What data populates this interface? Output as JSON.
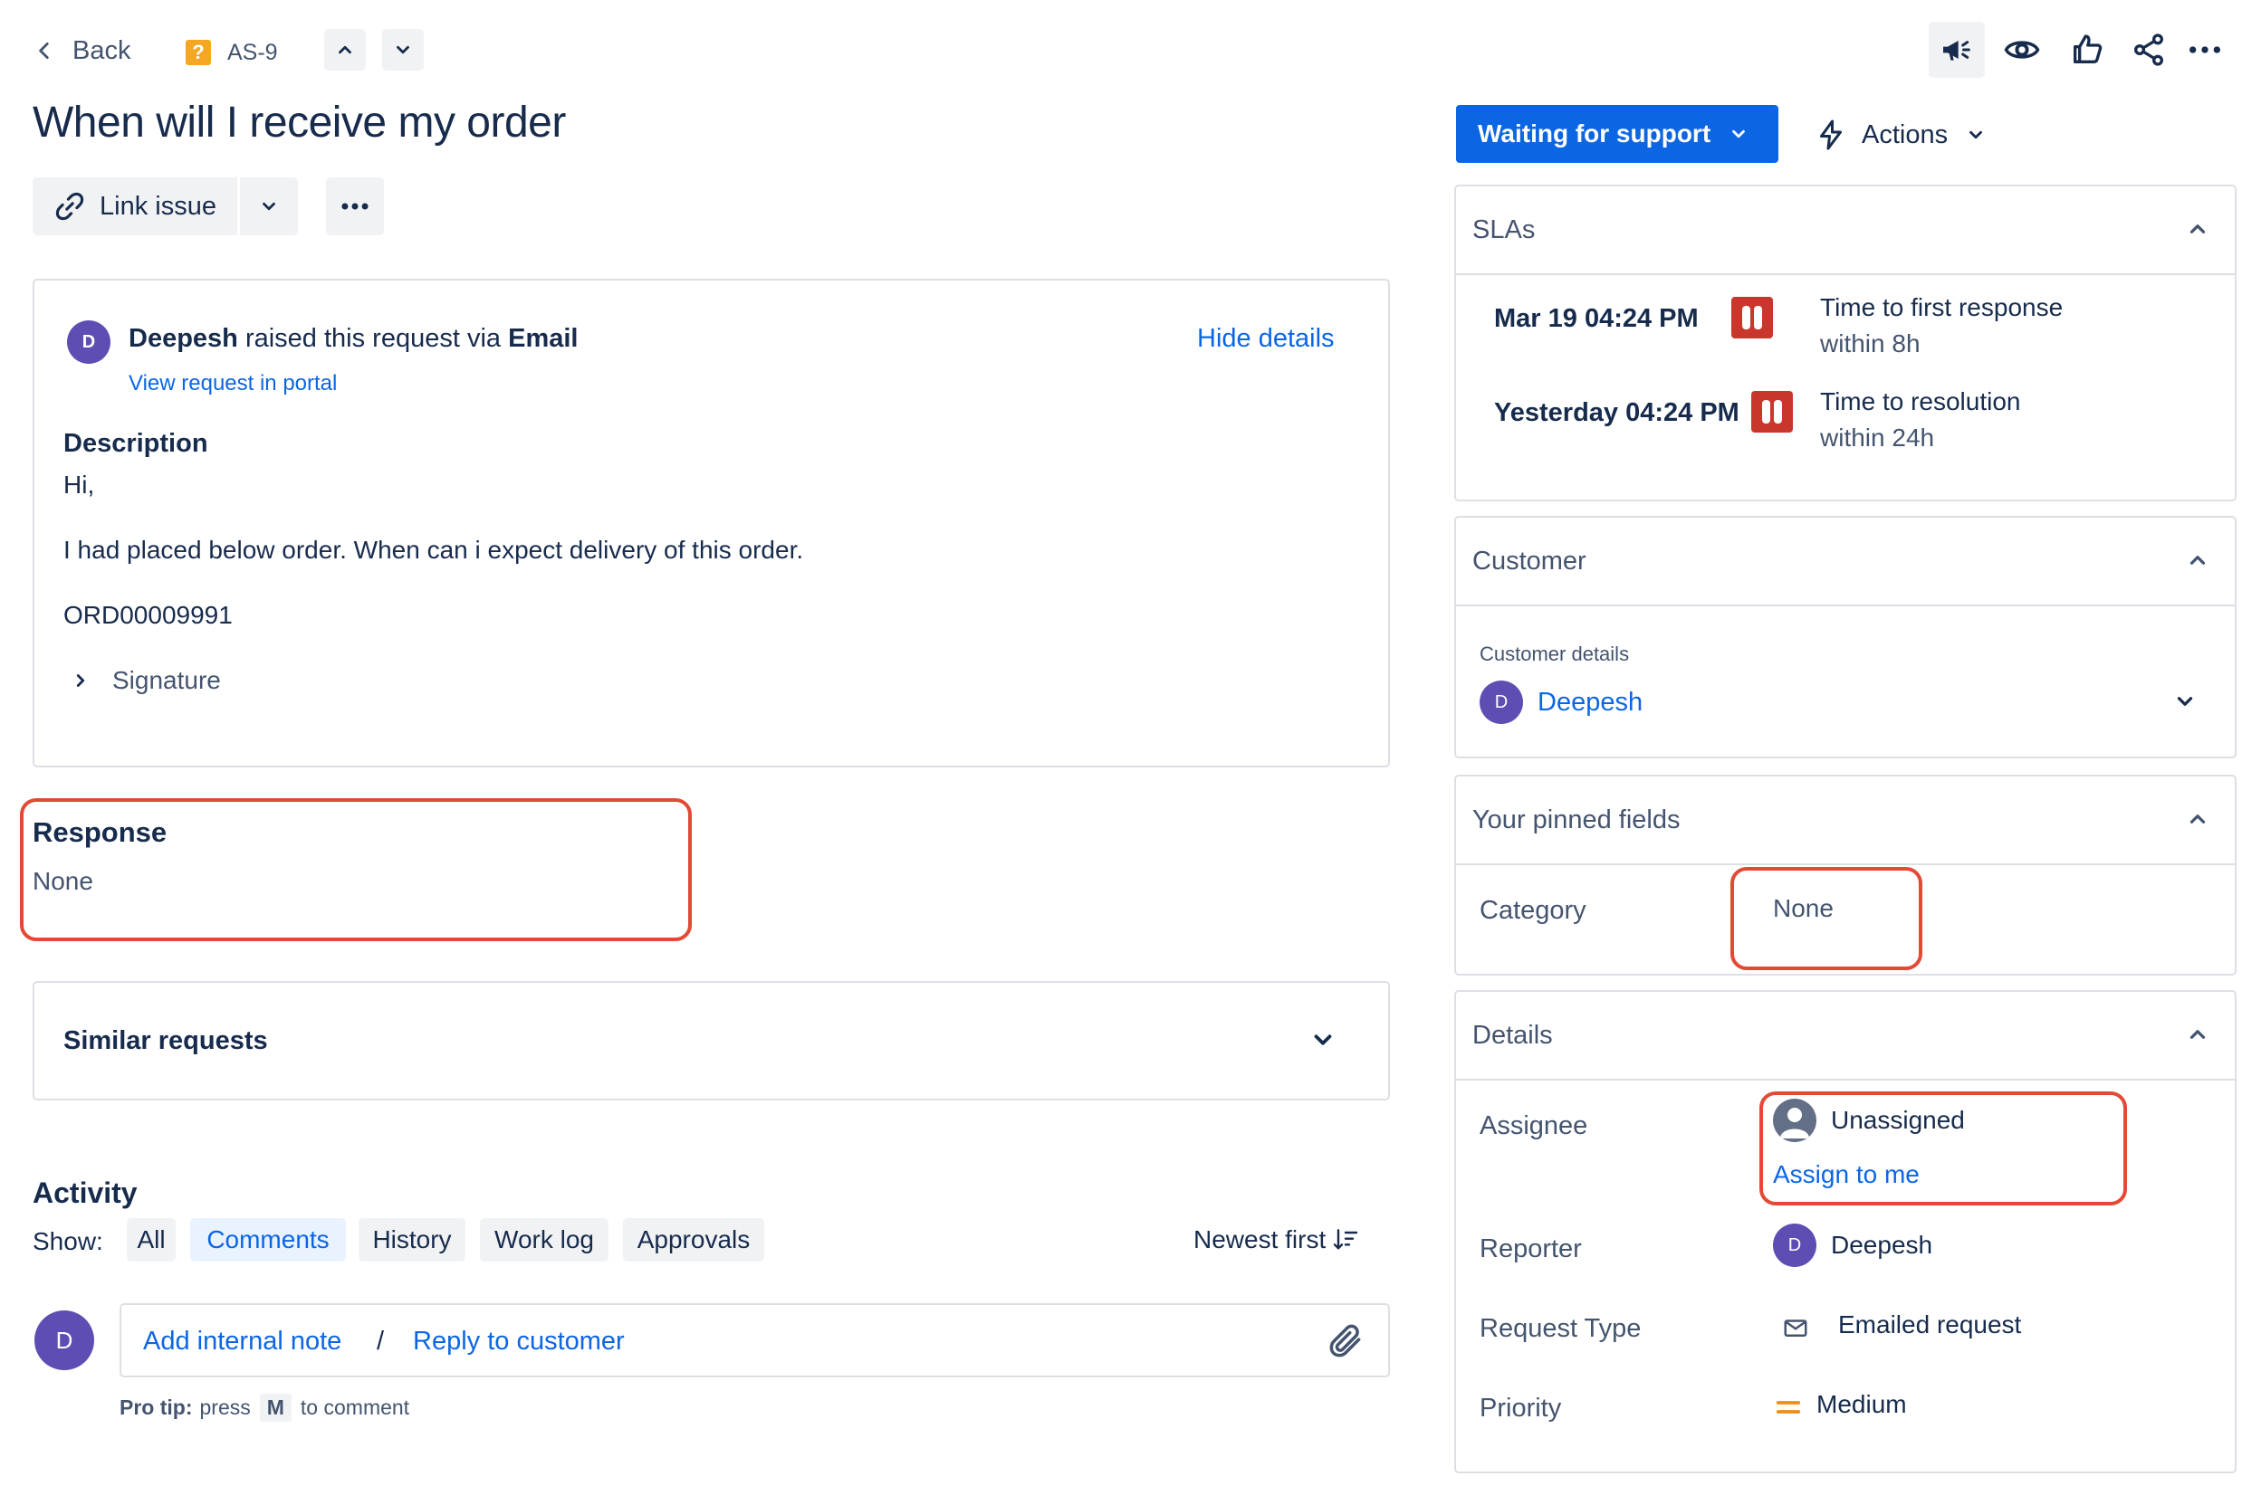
{
  "topbar": {
    "back_label": "Back",
    "issue_key": "AS-9",
    "issue_type_glyph": "?",
    "colors": {
      "issue_type": "#f5a623",
      "accent": "#0c66e4",
      "highlight": "#e34935"
    }
  },
  "title": "When will I receive my order",
  "toolbar": {
    "link_issue_label": "Link issue"
  },
  "request": {
    "avatar_initial": "D",
    "raiser": "Deepesh",
    "raised_via_text": "raised this request via",
    "channel": "Email",
    "hide_details": "Hide details",
    "view_in_portal": "View request in portal",
    "description_label": "Description",
    "lines": [
      "Hi,",
      "I had placed below order. When can i expect delivery of this order.",
      "ORD00009991"
    ],
    "signature_label": "Signature"
  },
  "response": {
    "label": "Response",
    "value": "None"
  },
  "similar": {
    "label": "Similar requests"
  },
  "activity": {
    "title": "Activity",
    "show_label": "Show:",
    "filters": [
      "All",
      "Comments",
      "History",
      "Work log",
      "Approvals"
    ],
    "active_filter": "Comments",
    "sort_label": "Newest first",
    "commenter_initial": "D",
    "add_internal_note": "Add internal note",
    "separator": "/",
    "reply_to_customer": "Reply to customer",
    "protip_bold": "Pro tip:",
    "protip_press": "press",
    "protip_key": "M",
    "protip_rest": "to comment"
  },
  "status": {
    "label": "Waiting for support",
    "actions_label": "Actions"
  },
  "slas": {
    "title": "SLAs",
    "items": [
      {
        "time": "Mar 19 04:24 PM",
        "name": "Time to first response",
        "goal": "within 8h",
        "state": "paused"
      },
      {
        "time": "Yesterday 04:24 PM",
        "name": "Time to resolution",
        "goal": "within 24h",
        "state": "paused"
      }
    ]
  },
  "customer": {
    "title": "Customer",
    "details_label": "Customer details",
    "avatar_initial": "D",
    "name": "Deepesh"
  },
  "pinned": {
    "title": "Your pinned fields",
    "category_label": "Category",
    "category_value": "None"
  },
  "details": {
    "title": "Details",
    "assignee_label": "Assignee",
    "assignee_value": "Unassigned",
    "assign_to_me": "Assign to me",
    "reporter_label": "Reporter",
    "reporter_initial": "D",
    "reporter_value": "Deepesh",
    "request_type_label": "Request Type",
    "request_type_value": "Emailed request",
    "priority_label": "Priority",
    "priority_value": "Medium"
  }
}
